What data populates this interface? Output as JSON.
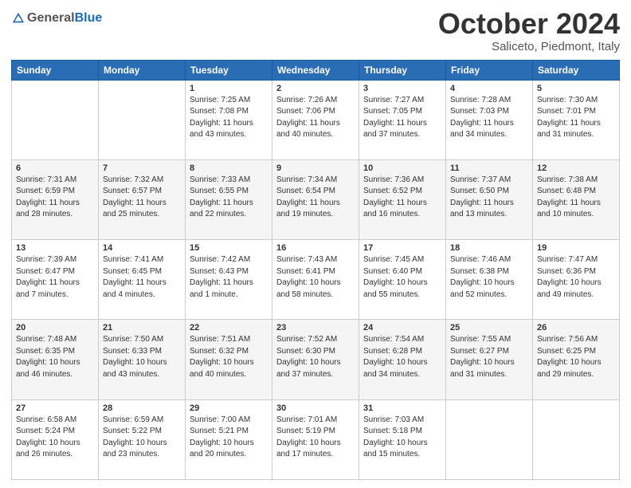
{
  "header": {
    "logo_general": "General",
    "logo_blue": "Blue",
    "month_title": "October 2024",
    "location": "Saliceto, Piedmont, Italy"
  },
  "days_of_week": [
    "Sunday",
    "Monday",
    "Tuesday",
    "Wednesday",
    "Thursday",
    "Friday",
    "Saturday"
  ],
  "weeks": [
    [
      {
        "day": "",
        "sunrise": "",
        "sunset": "",
        "daylight": ""
      },
      {
        "day": "",
        "sunrise": "",
        "sunset": "",
        "daylight": ""
      },
      {
        "day": "1",
        "sunrise": "Sunrise: 7:25 AM",
        "sunset": "Sunset: 7:08 PM",
        "daylight": "Daylight: 11 hours and 43 minutes."
      },
      {
        "day": "2",
        "sunrise": "Sunrise: 7:26 AM",
        "sunset": "Sunset: 7:06 PM",
        "daylight": "Daylight: 11 hours and 40 minutes."
      },
      {
        "day": "3",
        "sunrise": "Sunrise: 7:27 AM",
        "sunset": "Sunset: 7:05 PM",
        "daylight": "Daylight: 11 hours and 37 minutes."
      },
      {
        "day": "4",
        "sunrise": "Sunrise: 7:28 AM",
        "sunset": "Sunset: 7:03 PM",
        "daylight": "Daylight: 11 hours and 34 minutes."
      },
      {
        "day": "5",
        "sunrise": "Sunrise: 7:30 AM",
        "sunset": "Sunset: 7:01 PM",
        "daylight": "Daylight: 11 hours and 31 minutes."
      }
    ],
    [
      {
        "day": "6",
        "sunrise": "Sunrise: 7:31 AM",
        "sunset": "Sunset: 6:59 PM",
        "daylight": "Daylight: 11 hours and 28 minutes."
      },
      {
        "day": "7",
        "sunrise": "Sunrise: 7:32 AM",
        "sunset": "Sunset: 6:57 PM",
        "daylight": "Daylight: 11 hours and 25 minutes."
      },
      {
        "day": "8",
        "sunrise": "Sunrise: 7:33 AM",
        "sunset": "Sunset: 6:55 PM",
        "daylight": "Daylight: 11 hours and 22 minutes."
      },
      {
        "day": "9",
        "sunrise": "Sunrise: 7:34 AM",
        "sunset": "Sunset: 6:54 PM",
        "daylight": "Daylight: 11 hours and 19 minutes."
      },
      {
        "day": "10",
        "sunrise": "Sunrise: 7:36 AM",
        "sunset": "Sunset: 6:52 PM",
        "daylight": "Daylight: 11 hours and 16 minutes."
      },
      {
        "day": "11",
        "sunrise": "Sunrise: 7:37 AM",
        "sunset": "Sunset: 6:50 PM",
        "daylight": "Daylight: 11 hours and 13 minutes."
      },
      {
        "day": "12",
        "sunrise": "Sunrise: 7:38 AM",
        "sunset": "Sunset: 6:48 PM",
        "daylight": "Daylight: 11 hours and 10 minutes."
      }
    ],
    [
      {
        "day": "13",
        "sunrise": "Sunrise: 7:39 AM",
        "sunset": "Sunset: 6:47 PM",
        "daylight": "Daylight: 11 hours and 7 minutes."
      },
      {
        "day": "14",
        "sunrise": "Sunrise: 7:41 AM",
        "sunset": "Sunset: 6:45 PM",
        "daylight": "Daylight: 11 hours and 4 minutes."
      },
      {
        "day": "15",
        "sunrise": "Sunrise: 7:42 AM",
        "sunset": "Sunset: 6:43 PM",
        "daylight": "Daylight: 11 hours and 1 minute."
      },
      {
        "day": "16",
        "sunrise": "Sunrise: 7:43 AM",
        "sunset": "Sunset: 6:41 PM",
        "daylight": "Daylight: 10 hours and 58 minutes."
      },
      {
        "day": "17",
        "sunrise": "Sunrise: 7:45 AM",
        "sunset": "Sunset: 6:40 PM",
        "daylight": "Daylight: 10 hours and 55 minutes."
      },
      {
        "day": "18",
        "sunrise": "Sunrise: 7:46 AM",
        "sunset": "Sunset: 6:38 PM",
        "daylight": "Daylight: 10 hours and 52 minutes."
      },
      {
        "day": "19",
        "sunrise": "Sunrise: 7:47 AM",
        "sunset": "Sunset: 6:36 PM",
        "daylight": "Daylight: 10 hours and 49 minutes."
      }
    ],
    [
      {
        "day": "20",
        "sunrise": "Sunrise: 7:48 AM",
        "sunset": "Sunset: 6:35 PM",
        "daylight": "Daylight: 10 hours and 46 minutes."
      },
      {
        "day": "21",
        "sunrise": "Sunrise: 7:50 AM",
        "sunset": "Sunset: 6:33 PM",
        "daylight": "Daylight: 10 hours and 43 minutes."
      },
      {
        "day": "22",
        "sunrise": "Sunrise: 7:51 AM",
        "sunset": "Sunset: 6:32 PM",
        "daylight": "Daylight: 10 hours and 40 minutes."
      },
      {
        "day": "23",
        "sunrise": "Sunrise: 7:52 AM",
        "sunset": "Sunset: 6:30 PM",
        "daylight": "Daylight: 10 hours and 37 minutes."
      },
      {
        "day": "24",
        "sunrise": "Sunrise: 7:54 AM",
        "sunset": "Sunset: 6:28 PM",
        "daylight": "Daylight: 10 hours and 34 minutes."
      },
      {
        "day": "25",
        "sunrise": "Sunrise: 7:55 AM",
        "sunset": "Sunset: 6:27 PM",
        "daylight": "Daylight: 10 hours and 31 minutes."
      },
      {
        "day": "26",
        "sunrise": "Sunrise: 7:56 AM",
        "sunset": "Sunset: 6:25 PM",
        "daylight": "Daylight: 10 hours and 29 minutes."
      }
    ],
    [
      {
        "day": "27",
        "sunrise": "Sunrise: 6:58 AM",
        "sunset": "Sunset: 5:24 PM",
        "daylight": "Daylight: 10 hours and 26 minutes."
      },
      {
        "day": "28",
        "sunrise": "Sunrise: 6:59 AM",
        "sunset": "Sunset: 5:22 PM",
        "daylight": "Daylight: 10 hours and 23 minutes."
      },
      {
        "day": "29",
        "sunrise": "Sunrise: 7:00 AM",
        "sunset": "Sunset: 5:21 PM",
        "daylight": "Daylight: 10 hours and 20 minutes."
      },
      {
        "day": "30",
        "sunrise": "Sunrise: 7:01 AM",
        "sunset": "Sunset: 5:19 PM",
        "daylight": "Daylight: 10 hours and 17 minutes."
      },
      {
        "day": "31",
        "sunrise": "Sunrise: 7:03 AM",
        "sunset": "Sunset: 5:18 PM",
        "daylight": "Daylight: 10 hours and 15 minutes."
      },
      {
        "day": "",
        "sunrise": "",
        "sunset": "",
        "daylight": ""
      },
      {
        "day": "",
        "sunrise": "",
        "sunset": "",
        "daylight": ""
      }
    ]
  ]
}
